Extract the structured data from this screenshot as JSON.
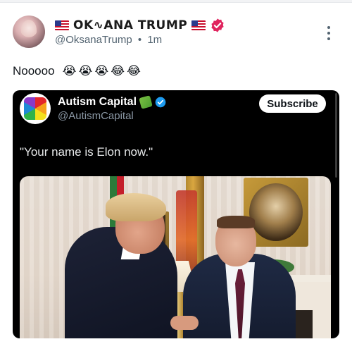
{
  "post": {
    "display_name": "OK∿ANA TRUMP",
    "handle": "@OksanaTrump",
    "separator": "•",
    "time": "1m",
    "text": "Nooooo",
    "emojis": [
      "😭",
      "😭",
      "😭",
      "😂",
      "😂"
    ],
    "icons": {
      "flag": "us-flag-icon",
      "verified": "verified-badge-icon",
      "more": "more-options-icon"
    },
    "colors": {
      "verified_badge": "#e0245e",
      "handle": "#536471"
    }
  },
  "quoted": {
    "name": "Autism Capital",
    "handle": "@AutismCapital",
    "subscribe_label": "Subscribe",
    "quote": "\"Your name is Elon now.\"",
    "colors": {
      "card_bg": "#000000",
      "verified_badge": "#1d9bf0",
      "handle": "#8b98a5"
    },
    "icons": {
      "avatar": "rainbow-puzzle-icon",
      "puzzle": "puzzle-piece-icon",
      "verified": "verified-badge-icon"
    }
  }
}
